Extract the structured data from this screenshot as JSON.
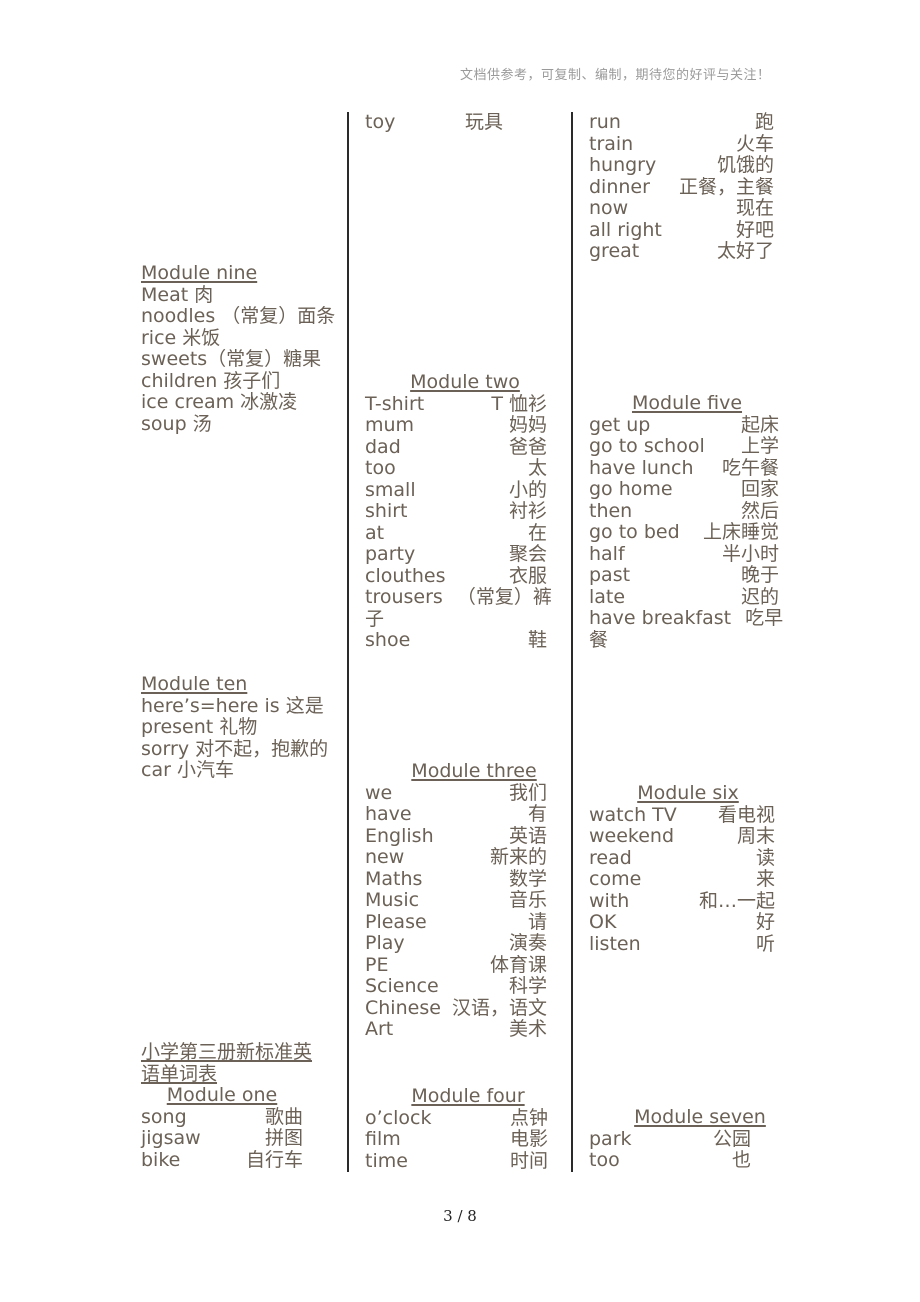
{
  "header_note": "文档供参考，可复制、编制，期待您的好评与关注！",
  "page_number": "3 / 8",
  "col1": {
    "module_nine": {
      "title": "Module nine",
      "lines": [
        "Meat 肉",
        "noodles （常复）面条",
        "rice 米饭",
        "sweets（常复）糖果",
        "children 孩子们",
        "ice cream 冰激凌",
        "soup 汤"
      ]
    },
    "module_ten": {
      "title": "Module ten",
      "lines": [
        "here’s=here is 这是",
        "present  礼物",
        "sorry 对不起，抱歉的",
        "car 小汽车"
      ]
    },
    "book_title": "小学第三册新标准英语单词表",
    "module_one": {
      "title": "Module one",
      "words": [
        {
          "en": "song",
          "zh": "歌曲"
        },
        {
          "en": "jigsaw",
          "zh": "拼图"
        },
        {
          "en": "bike",
          "zh": "自行车"
        }
      ]
    }
  },
  "col2": {
    "top_words": [
      {
        "en": "toy",
        "zh": "玩具"
      }
    ],
    "module_two": {
      "title": "Module two",
      "words": [
        {
          "en": "T-shirt",
          "zh": "T 恤衫"
        },
        {
          "en": "mum",
          "zh": "妈妈"
        },
        {
          "en": "dad",
          "zh": "爸爸"
        },
        {
          "en": "too",
          "zh": "太"
        },
        {
          "en": "small",
          "zh": "小的"
        },
        {
          "en": "shirt",
          "zh": "衬衫"
        },
        {
          "en": "at",
          "zh": "在"
        },
        {
          "en": "party",
          "zh": "聚会"
        },
        {
          "en": "clouthes",
          "zh": "衣服"
        },
        {
          "en": "trousers",
          "zh": "（常复）裤子"
        },
        {
          "en": "shoe",
          "zh": "鞋"
        }
      ]
    },
    "module_three": {
      "title": "Module three",
      "words": [
        {
          "en": "we",
          "zh": "我们"
        },
        {
          "en": "have",
          "zh": "有"
        },
        {
          "en": "English",
          "zh": "英语"
        },
        {
          "en": "new",
          "zh": "新来的"
        },
        {
          "en": "Maths",
          "zh": "数学"
        },
        {
          "en": "Music",
          "zh": "音乐"
        },
        {
          "en": "Please",
          "zh": "请"
        },
        {
          "en": "Play",
          "zh": "演奏"
        },
        {
          "en": "PE",
          "zh": "体育课"
        },
        {
          "en": "Science",
          "zh": "科学"
        },
        {
          "en": "Chinese",
          "zh": "汉语，语文"
        },
        {
          "en": "Art",
          "zh": "美术"
        }
      ]
    },
    "module_four": {
      "title": "Module four",
      "words": [
        {
          "en": "o’clock",
          "zh": "点钟"
        },
        {
          "en": "film",
          "zh": "电影"
        },
        {
          "en": "time",
          "zh": "时间"
        }
      ]
    }
  },
  "col3": {
    "top_words": [
      {
        "en": "run",
        "zh": "跑"
      },
      {
        "en": "train",
        "zh": "火车"
      },
      {
        "en": "hungry",
        "zh": "饥饿的"
      },
      {
        "en": "dinner",
        "zh": "正餐，主餐"
      },
      {
        "en": "now",
        "zh": "现在"
      },
      {
        "en": "all right",
        "zh": "好吧"
      },
      {
        "en": "great",
        "zh": "太好了"
      }
    ],
    "module_five": {
      "title": "Module five",
      "words": [
        {
          "en": "get up",
          "zh": "起床"
        },
        {
          "en": "go to school",
          "zh": "上学"
        },
        {
          "en": "have lunch",
          "zh": "吃午餐"
        },
        {
          "en": "go home",
          "zh": "回家"
        },
        {
          "en": "then",
          "zh": "然后"
        },
        {
          "en": "go to bed",
          "zh": "上床睡觉"
        },
        {
          "en": "half",
          "zh": "半小时"
        },
        {
          "en": "past",
          "zh": "晚于"
        },
        {
          "en": "late",
          "zh": "迟的"
        },
        {
          "en": "have breakfast",
          "zh": "吃早餐"
        }
      ]
    },
    "module_six": {
      "title": "Module six",
      "words": [
        {
          "en": "watch TV",
          "zh": "看电视"
        },
        {
          "en": "weekend",
          "zh": "周末"
        },
        {
          "en": "read",
          "zh": "读"
        },
        {
          "en": "come",
          "zh": "来"
        },
        {
          "en": "with",
          "zh": "和…一起"
        },
        {
          "en": "OK",
          "zh": "好"
        },
        {
          "en": "listen",
          "zh": "听"
        }
      ]
    },
    "module_seven": {
      "title": "Module seven",
      "words": [
        {
          "en": "park",
          "zh": "公园"
        },
        {
          "en": "too",
          "zh": "也"
        }
      ]
    }
  }
}
